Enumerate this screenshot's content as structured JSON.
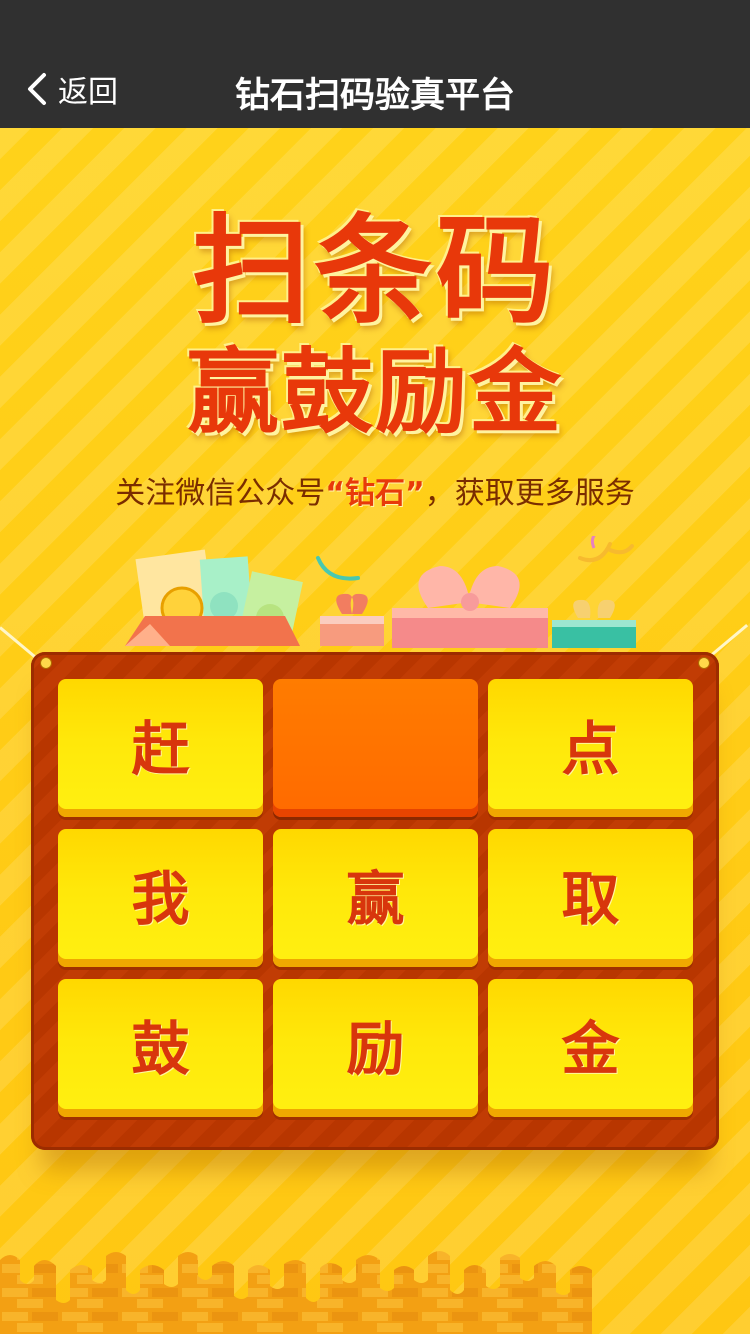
{
  "nav": {
    "back_label": "返回",
    "title": "钻石扫码验真平台"
  },
  "promo": {
    "headline_1": "扫条码",
    "headline_2": "赢鼓励金",
    "sub_prefix": "关注微信公众号",
    "sub_accent": "“钻石”",
    "sub_suffix": "，获取更多服务"
  },
  "grid": {
    "cells": [
      {
        "char": "赶",
        "state": "normal"
      },
      {
        "char": "",
        "state": "active"
      },
      {
        "char": "点",
        "state": "normal"
      },
      {
        "char": "我",
        "state": "normal"
      },
      {
        "char": "赢",
        "state": "normal"
      },
      {
        "char": "取",
        "state": "normal"
      },
      {
        "char": "鼓",
        "state": "normal"
      },
      {
        "char": "励",
        "state": "normal"
      },
      {
        "char": "金",
        "state": "normal"
      }
    ]
  },
  "icons": {
    "back": "chevron-left-icon"
  },
  "colors": {
    "nav_bg": "#303030",
    "page_bg": "#ffc712",
    "headline": "#e8380a",
    "board": "#c13c04",
    "cell": "#ffe80a",
    "cell_active": "#ff6a00"
  }
}
